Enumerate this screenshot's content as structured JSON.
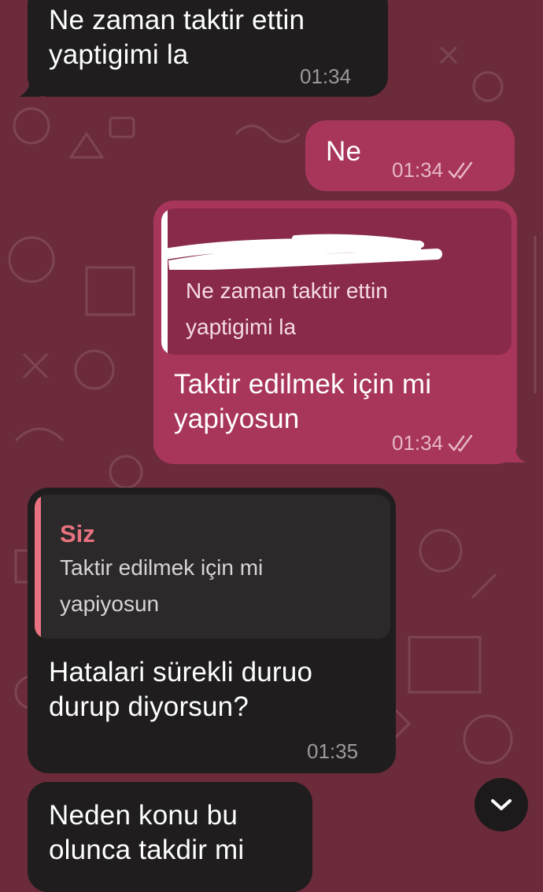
{
  "messages": [
    {
      "id": "m1",
      "direction": "in",
      "text_line1": "Ne zaman taktir ettin",
      "text_line2": "yaptigimi la",
      "time": "01:34"
    },
    {
      "id": "m2",
      "direction": "out",
      "text": "Ne",
      "time": "01:34",
      "status": "read"
    },
    {
      "id": "m3",
      "direction": "out",
      "quote": {
        "text_line1": "Ne zaman taktir ettin",
        "text_line2": "yaptigimi la"
      },
      "text_line1": "Taktir edilmek için mi",
      "text_line2": "yapiyosun",
      "time": "01:34",
      "status": "read"
    },
    {
      "id": "m4",
      "direction": "in",
      "quote": {
        "author": "Siz",
        "text_line1": "Taktir edilmek için mi",
        "text_line2": "yapiyosun"
      },
      "text_line1": "Hatalari sürekli duruo",
      "text_line2": "durup diyorsun?",
      "time": "01:35"
    },
    {
      "id": "m5",
      "direction": "in",
      "text_line1": "Neden konu bu",
      "text_line2": "olunca takdir mi"
    }
  ],
  "colors": {
    "background": "#6b2b3a",
    "incoming_bubble": "#1f1d1e",
    "outgoing_bubble": "#a8365a",
    "quote_author": "#e8727f"
  },
  "icons": {
    "read_status": "double-check-icon",
    "scroll_down": "chevron-down-icon"
  }
}
